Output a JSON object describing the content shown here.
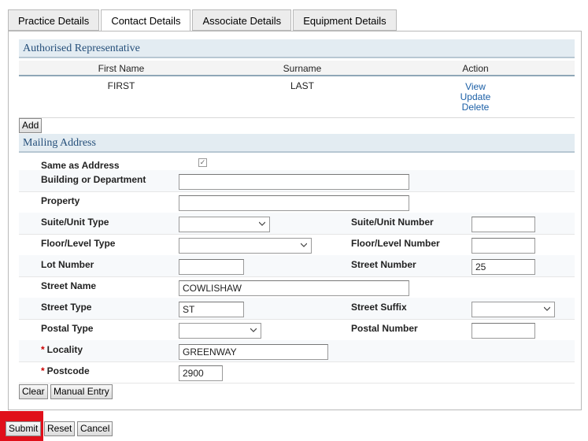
{
  "tabs": [
    {
      "label": "Practice Details"
    },
    {
      "label": "Contact Details"
    },
    {
      "label": "Associate Details"
    },
    {
      "label": "Equipment Details"
    }
  ],
  "authorised_rep": {
    "title": "Authorised Representative",
    "columns": [
      "First Name",
      "Surname",
      "Action"
    ],
    "rows": [
      {
        "first_name": "FIRST",
        "surname": "LAST",
        "actions": [
          "View",
          "Update",
          "Delete"
        ]
      }
    ],
    "add_label": "Add"
  },
  "mailing": {
    "title": "Mailing Address",
    "same_as_address_label": "Same as Address",
    "same_as_address_checked": true,
    "building_label": "Building or Department",
    "building_value": "",
    "property_label": "Property",
    "property_value": "",
    "suite_type_label": "Suite/Unit Type",
    "suite_type_value": "",
    "suite_number_label": "Suite/Unit Number",
    "suite_number_value": "",
    "floor_type_label": "Floor/Level Type",
    "floor_type_value": "",
    "floor_number_label": "Floor/Level Number",
    "floor_number_value": "",
    "lot_number_label": "Lot Number",
    "lot_number_value": "",
    "street_number_label": "Street Number",
    "street_number_value": "25",
    "street_name_label": "Street Name",
    "street_name_value": "COWLISHAW",
    "street_type_label": "Street Type",
    "street_type_value": "ST",
    "street_suffix_label": "Street Suffix",
    "street_suffix_value": "",
    "postal_type_label": "Postal Type",
    "postal_type_value": "",
    "postal_number_label": "Postal Number",
    "postal_number_value": "",
    "locality_label": "Locality",
    "locality_value": "GREENWAY",
    "postcode_label": "Postcode",
    "postcode_value": "2900",
    "required_marker": "*",
    "clear_label": "Clear",
    "manual_entry_label": "Manual Entry"
  },
  "footer": {
    "submit_label": "Submit",
    "reset_label": "Reset",
    "cancel_label": "Cancel"
  },
  "colors": {
    "section_header_bg": "#e3ecf2",
    "section_header_text": "#254f7a",
    "link": "#1b5fa6",
    "required": "#cc0000",
    "highlight": "#e0101a"
  }
}
